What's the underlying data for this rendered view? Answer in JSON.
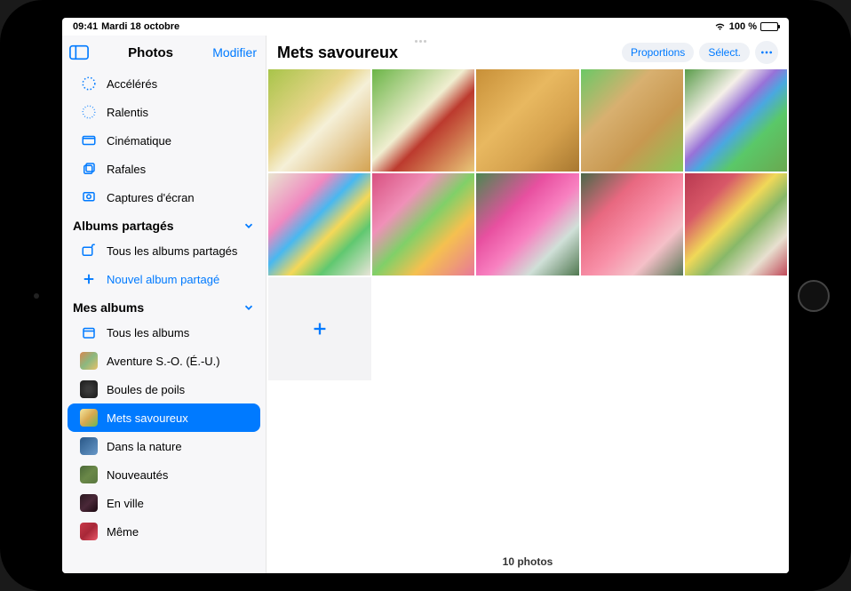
{
  "status": {
    "time": "09:41",
    "date": "Mardi 18 octobre",
    "battery_pct": "100 %"
  },
  "sidebar": {
    "title": "Photos",
    "edit": "Modifier",
    "mediaTypes": [
      {
        "label": "Accélérés"
      },
      {
        "label": "Ralentis"
      },
      {
        "label": "Cinématique"
      },
      {
        "label": "Rafales"
      },
      {
        "label": "Captures d'écran"
      }
    ],
    "sharedSection": "Albums partagés",
    "sharedAll": "Tous les albums partagés",
    "newShared": "Nouvel album partagé",
    "myAlbumsSection": "Mes albums",
    "allAlbums": "Tous les albums",
    "albums": [
      {
        "label": "Aventure S.-O. (É.-U.)"
      },
      {
        "label": "Boules de poils"
      },
      {
        "label": "Mets savoureux"
      },
      {
        "label": "Dans la nature"
      },
      {
        "label": "Nouveautés"
      },
      {
        "label": "En ville"
      },
      {
        "label": "Même"
      }
    ]
  },
  "main": {
    "title": "Mets savoureux",
    "aspect": "Proportions",
    "select": "Sélect.",
    "footer": "10 photos"
  }
}
